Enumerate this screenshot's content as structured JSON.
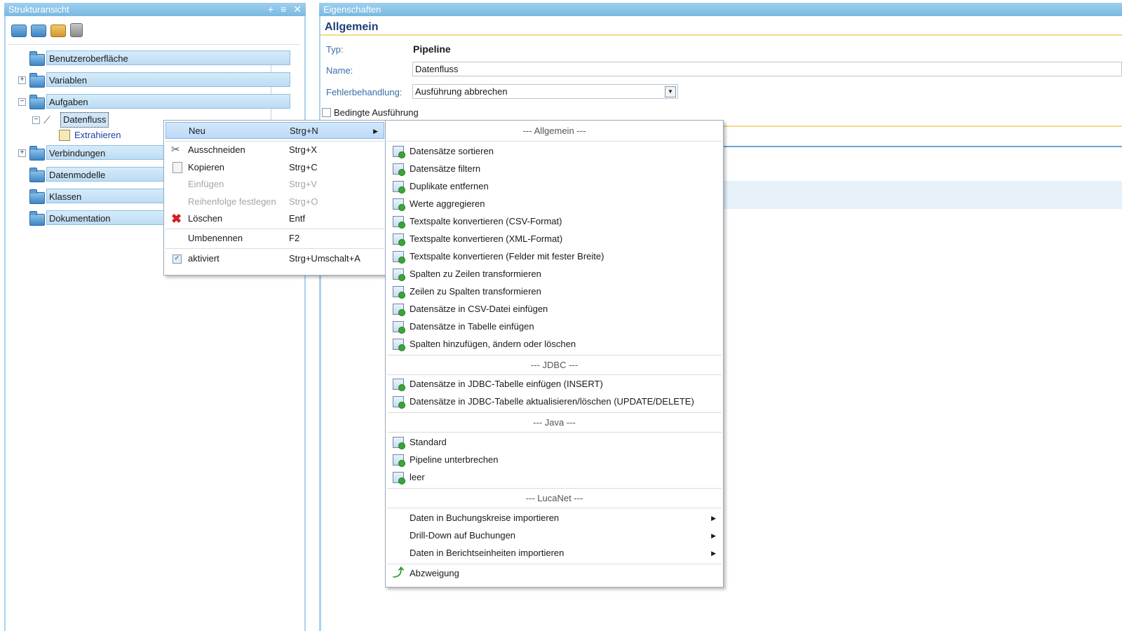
{
  "left_panel": {
    "title": "Strukturansicht",
    "title_buttons": [
      "+",
      "≡",
      "✕"
    ],
    "toolbar_icons": [
      "new-folder-icon",
      "folder-icon",
      "settings-folder-icon",
      "documents-icon"
    ],
    "tree": {
      "items": [
        {
          "label": "Benutzeroberfläche",
          "expander": ""
        },
        {
          "label": "Variablen",
          "expander": "+"
        },
        {
          "label": "Aufgaben",
          "expander": "−"
        },
        {
          "label": "Datenfluss",
          "expander": "−"
        },
        {
          "label": "Extrahieren",
          "expander": ""
        },
        {
          "label": "Verbindungen",
          "expander": "+"
        },
        {
          "label": "Datenmodelle",
          "expander": ""
        },
        {
          "label": "Klassen",
          "expander": ""
        },
        {
          "label": "Dokumentation",
          "expander": ""
        }
      ]
    }
  },
  "right_panel": {
    "title": "Eigenschaften",
    "section": "Allgemein",
    "typ_label": "Typ:",
    "typ_value": "Pipeline",
    "name_label": "Name:",
    "name_value": "Datenfluss",
    "fehler_label": "Fehlerbehandlung:",
    "fehler_value": "Ausführung abbrechen",
    "bedingt_label": "Bedingte Ausführung"
  },
  "context_menu": {
    "items": [
      {
        "label": "Neu",
        "shortcut": "Strg+N"
      },
      {
        "label": "Ausschneiden",
        "shortcut": "Strg+X"
      },
      {
        "label": "Kopieren",
        "shortcut": "Strg+C"
      },
      {
        "label": "Einfügen",
        "shortcut": "Strg+V"
      },
      {
        "label": "Reihenfolge festlegen",
        "shortcut": "Strg+O"
      },
      {
        "label": "Löschen",
        "shortcut": "Entf"
      },
      {
        "label": "Umbenennen",
        "shortcut": "F2"
      },
      {
        "label": "aktiviert",
        "shortcut": "Strg+Umschalt+A"
      }
    ]
  },
  "submenu": {
    "headers": {
      "allgemein": "--- Allgemein ---",
      "jdbc": "--- JDBC ---",
      "java": "--- Java ---",
      "lucanet": "--- LucaNet ---"
    },
    "allgemein_items": [
      "Datensätze sortieren",
      "Datensätze filtern",
      "Duplikate entfernen",
      "Werte aggregieren",
      "Textspalte konvertieren (CSV-Format)",
      "Textspalte konvertieren (XML-Format)",
      "Textspalte konvertieren (Felder mit fester Breite)",
      "Spalten zu Zeilen transformieren",
      "Zeilen zu Spalten transformieren",
      "Datensätze in CSV-Datei einfügen",
      "Datensätze in Tabelle einfügen",
      "Spalten hinzufügen, ändern oder löschen"
    ],
    "jdbc_items": [
      "Datensätze in JDBC-Tabelle einfügen (INSERT)",
      "Datensätze in JDBC-Tabelle aktualisieren/löschen (UPDATE/DELETE)"
    ],
    "java_items": [
      "Standard",
      "Pipeline unterbrechen",
      "leer"
    ],
    "lucanet_items": [
      "Daten in Buchungskreise importieren",
      "Drill-Down auf Buchungen",
      "Daten in Berichtseinheiten importieren"
    ],
    "last_item": "Abzweigung"
  }
}
